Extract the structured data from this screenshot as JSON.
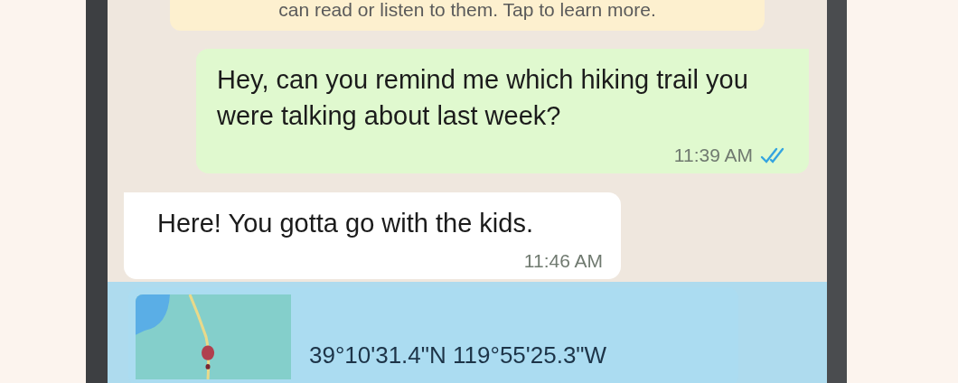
{
  "notice": {
    "text": "can read or listen to them. Tap to learn more."
  },
  "messages": [
    {
      "kind": "outgoing",
      "text": "Hey, can you remind me which hiking trail you were talking about last week?",
      "time": "11:39 AM",
      "read": true
    },
    {
      "kind": "incoming",
      "text": "Here! You gotta go with the kids.",
      "time": "11:46 AM"
    },
    {
      "kind": "location",
      "coordinates": "39°10'31.4\"N 119°55'25.3\"W",
      "selected": true
    }
  ]
}
